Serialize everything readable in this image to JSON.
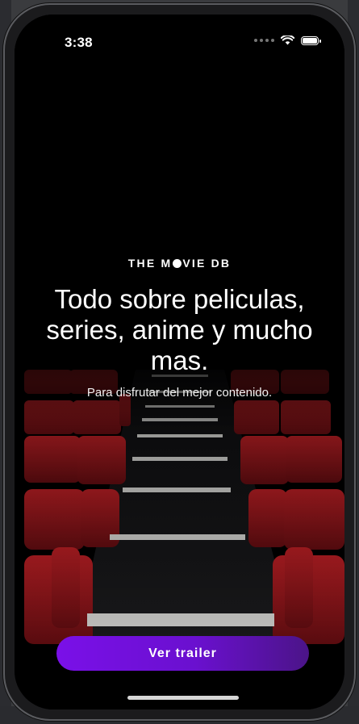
{
  "status_bar": {
    "time": "3:38"
  },
  "hero": {
    "brand_before": "THE M",
    "brand_after": "VIE DB",
    "headline": "Todo sobre peliculas, series, anime y mucho mas.",
    "subtitle": "Para disfrutar del mejor contenido."
  },
  "cta": {
    "label": "Ver trailer"
  },
  "colors": {
    "accent_start": "#7a10e8",
    "accent_end": "#4b1488",
    "seat_red": "#8e1418",
    "background": "#000000"
  },
  "icons": [
    "signal-dots-icon",
    "wifi-icon",
    "battery-icon"
  ]
}
